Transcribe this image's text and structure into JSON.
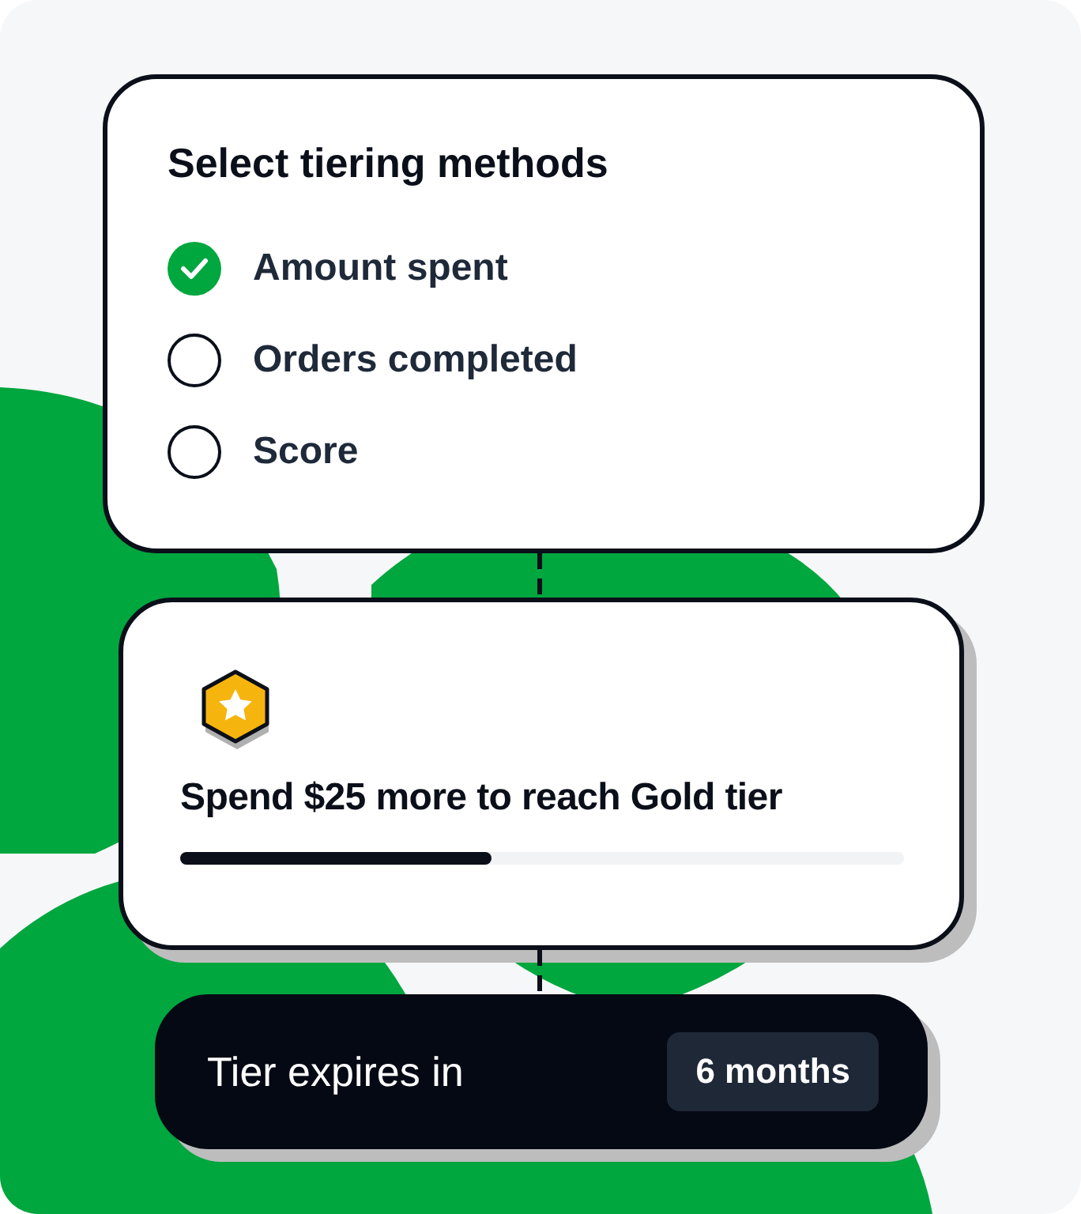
{
  "methods_card": {
    "title": "Select tiering methods",
    "options": [
      {
        "label": "Amount spent",
        "checked": true
      },
      {
        "label": "Orders completed",
        "checked": false
      },
      {
        "label": "Score",
        "checked": false
      }
    ]
  },
  "progress_card": {
    "message": "Spend $25 more to reach Gold tier",
    "level": 0.43
  },
  "expiry_card": {
    "label": "Tier expires in",
    "value": "6 months"
  }
}
